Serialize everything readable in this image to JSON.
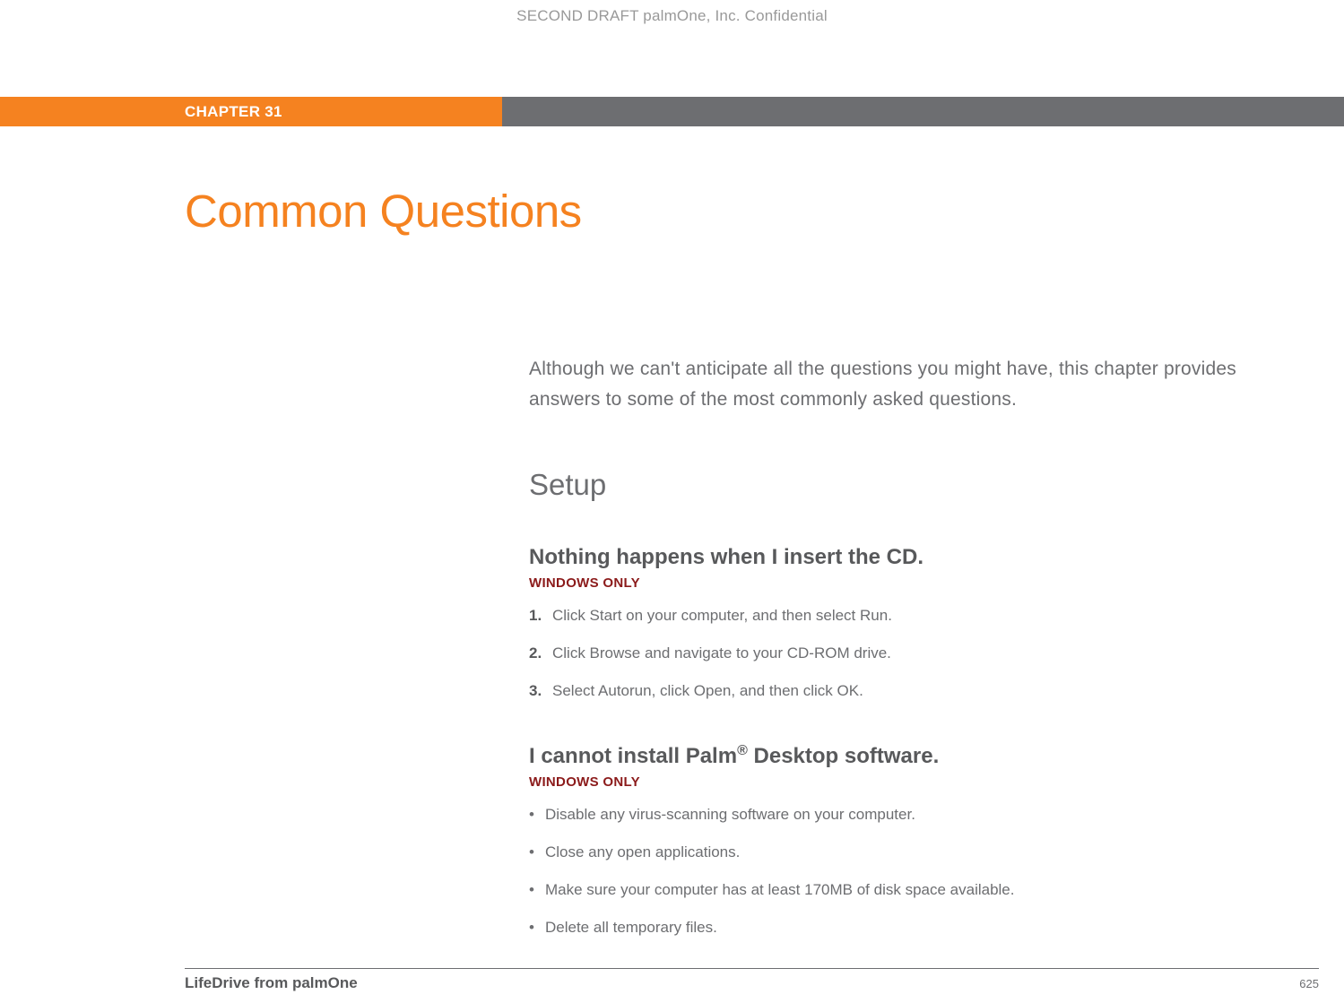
{
  "header": {
    "confidential": "SECOND DRAFT palmOne, Inc.  Confidential"
  },
  "chapter": {
    "label": "CHAPTER 31"
  },
  "title": "Common Questions",
  "intro": "Although we can't anticipate all the questions you might have, this chapter provides answers to some of the most commonly asked questions.",
  "section": {
    "heading": "Setup",
    "q1": {
      "title": "Nothing happens when I insert the CD.",
      "badge": "WINDOWS ONLY",
      "steps": [
        {
          "num": "1.",
          "text": "Click Start on your computer, and then select Run."
        },
        {
          "num": "2.",
          "text": "Click Browse and navigate to your CD-ROM drive."
        },
        {
          "num": "3.",
          "text": "Select Autorun, click Open, and then click OK."
        }
      ]
    },
    "q2": {
      "title_pre": "I cannot install Palm",
      "title_sup": "®",
      "title_post": " Desktop software.",
      "badge": "WINDOWS ONLY",
      "bullets": [
        "Disable any virus-scanning software on your computer.",
        "Close any open applications.",
        "Make sure your computer has at least 170MB of disk space available.",
        "Delete all temporary files."
      ]
    }
  },
  "footer": {
    "product": "LifeDrive from palmOne",
    "page": "625"
  }
}
